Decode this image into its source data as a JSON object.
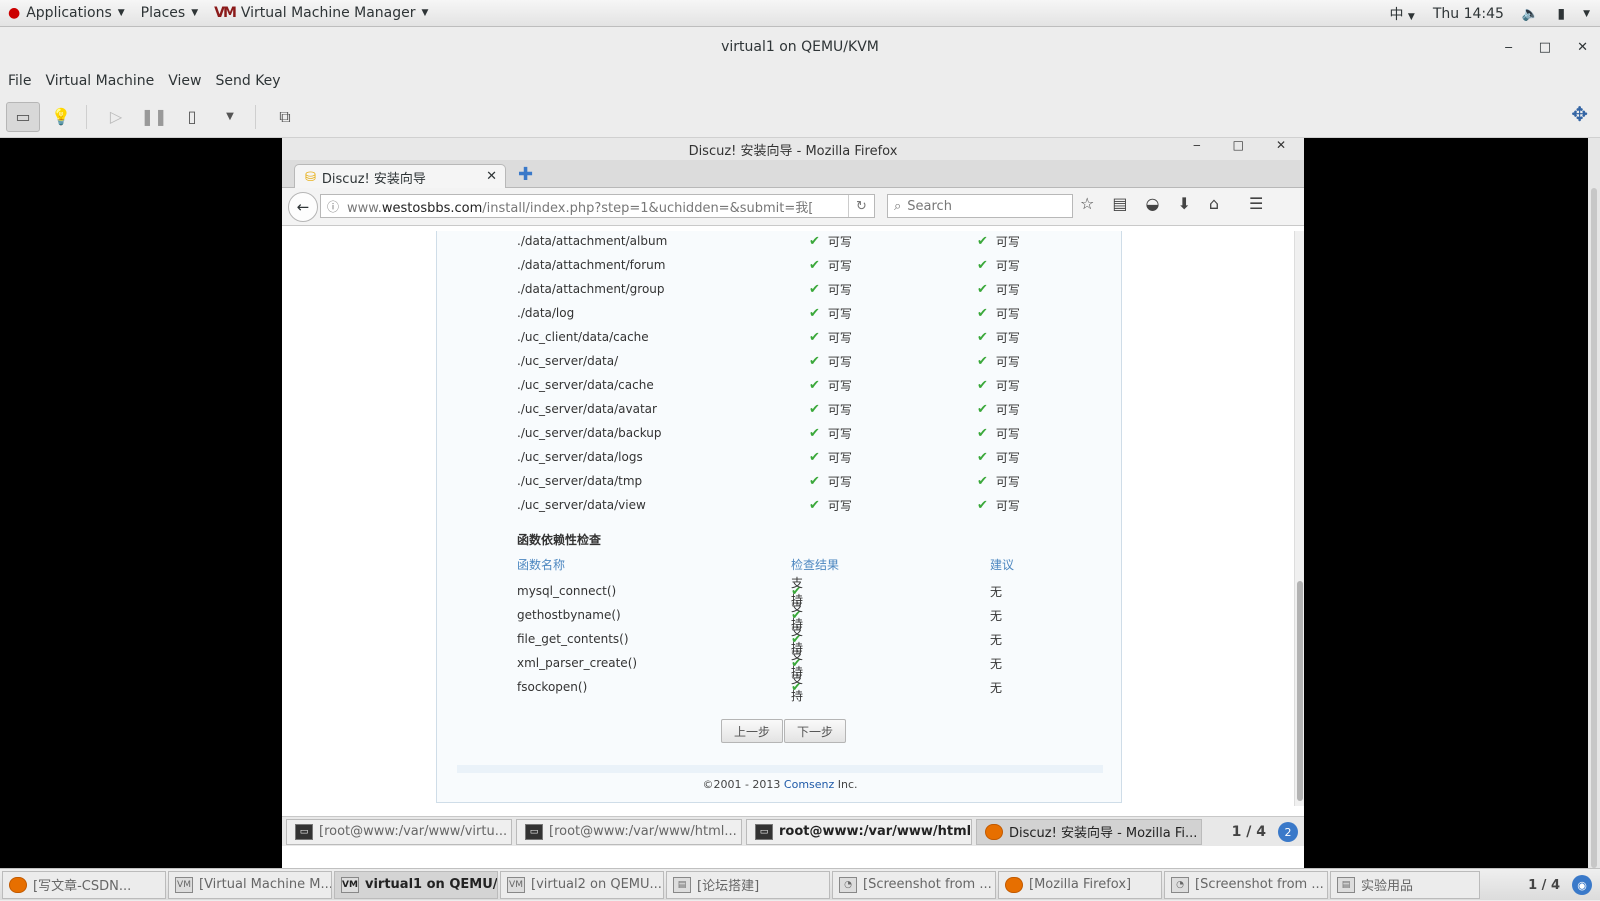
{
  "topbar": {
    "applications": "Applications",
    "places": "Places",
    "app_name": "Virtual Machine Manager",
    "app_logo": "VM",
    "input_method": "中",
    "clock": "Thu 14:45"
  },
  "window": {
    "title": "virtual1 on QEMU/KVM",
    "menus": [
      "File",
      "Virtual Machine",
      "View",
      "Send Key"
    ]
  },
  "guest": {
    "firefox_title": "Discuz! 安装向导 - Mozilla Firefox",
    "tab_label": "Discuz! 安装向导",
    "url_prefix": "www.",
    "url_domain": "westosbbs.com",
    "url_rest": "/install/index.php?step=1&uchidden=&submit=我[",
    "search_placeholder": "Search",
    "dir_rows": [
      {
        "path": "./data/attachment/album",
        "c1": "可写",
        "c2": "可写"
      },
      {
        "path": "./data/attachment/forum",
        "c1": "可写",
        "c2": "可写"
      },
      {
        "path": "./data/attachment/group",
        "c1": "可写",
        "c2": "可写"
      },
      {
        "path": "./data/log",
        "c1": "可写",
        "c2": "可写"
      },
      {
        "path": "./uc_client/data/cache",
        "c1": "可写",
        "c2": "可写"
      },
      {
        "path": "./uc_server/data/",
        "c1": "可写",
        "c2": "可写"
      },
      {
        "path": "./uc_server/data/cache",
        "c1": "可写",
        "c2": "可写"
      },
      {
        "path": "./uc_server/data/avatar",
        "c1": "可写",
        "c2": "可写"
      },
      {
        "path": "./uc_server/data/backup",
        "c1": "可写",
        "c2": "可写"
      },
      {
        "path": "./uc_server/data/logs",
        "c1": "可写",
        "c2": "可写"
      },
      {
        "path": "./uc_server/data/tmp",
        "c1": "可写",
        "c2": "可写"
      },
      {
        "path": "./uc_server/data/view",
        "c1": "可写",
        "c2": "可写"
      }
    ],
    "func_section_title": "函数依赖性检查",
    "func_headers": {
      "name": "函数名称",
      "result": "检查结果",
      "advice": "建议"
    },
    "func_rows": [
      {
        "name": "mysql_connect()",
        "result": "支持",
        "advice": "无"
      },
      {
        "name": "gethostbyname()",
        "result": "支持",
        "advice": "无"
      },
      {
        "name": "file_get_contents()",
        "result": "支持",
        "advice": "无"
      },
      {
        "name": "xml_parser_create()",
        "result": "支持",
        "advice": "无"
      },
      {
        "name": "fsockopen()",
        "result": "支持",
        "advice": "无"
      }
    ],
    "prev_button": "上一步",
    "next_button": "下一步",
    "footer_prefix": "©2001 - 2013 ",
    "footer_link": "Comsenz",
    "footer_suffix": " Inc.",
    "taskbar": [
      {
        "label": "[root@www:/var/www/virtu...",
        "icon": "terminal-icon"
      },
      {
        "label": "[root@www:/var/www/html...",
        "icon": "terminal-icon"
      },
      {
        "label": "root@www:/var/www/html/...",
        "icon": "terminal-icon"
      },
      {
        "label": "Discuz! 安装向导 - Mozilla Fi...",
        "icon": "firefox-icon"
      }
    ],
    "pager": "1 / 4",
    "badge": "2"
  },
  "host_taskbar": {
    "items": [
      "[写文章-CSDN...",
      "[Virtual Machine M...",
      "virtual1 on QEMU/...",
      "[virtual2 on QEMU...",
      "[论坛搭建]",
      "[Screenshot from ...",
      "[Mozilla Firefox]",
      "[Screenshot from ...",
      "实验用品"
    ],
    "pager": "1 / 4"
  }
}
